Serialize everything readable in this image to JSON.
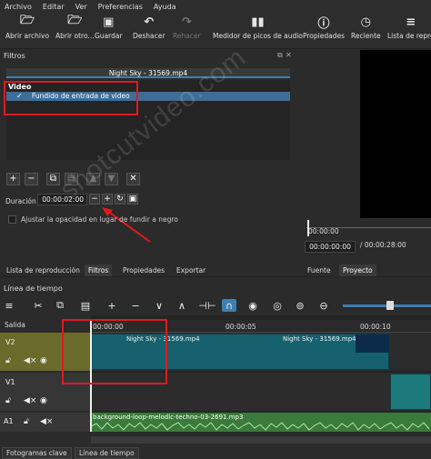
{
  "menu": [
    "Archivo",
    "Editar",
    "Ver",
    "Preferencias",
    "Ayuda"
  ],
  "toolbar": [
    {
      "label": "Abrir archivo",
      "icon": "folder-open-icon",
      "glyph": "▭"
    },
    {
      "label": "Abrir otro...",
      "icon": "folder-open-other-icon",
      "glyph": "▭"
    },
    {
      "label": "Guardar",
      "icon": "save-icon",
      "glyph": "▣"
    },
    {
      "label": "Deshacer",
      "icon": "undo-icon",
      "glyph": "↶"
    },
    {
      "label": "Rehacer",
      "icon": "redo-icon",
      "glyph": "↷"
    },
    {
      "label": "Medidor de picos de audio",
      "icon": "audio-meter-icon",
      "glyph": "▮"
    },
    {
      "label": "Propiedades",
      "icon": "properties-icon",
      "glyph": "ⓘ"
    },
    {
      "label": "Reciente",
      "icon": "recent-icon",
      "glyph": "◷"
    },
    {
      "label": "Lista de repro",
      "icon": "playlist-icon",
      "glyph": "≡"
    }
  ],
  "filters": {
    "title": "Filtros",
    "file": "Night Sky - 31569.mp4",
    "section": "Video",
    "item_check": "✓",
    "item": "Fundido de entrada de video",
    "duration_label": "Duración",
    "duration_value": "00:00:02:00",
    "opacity_label": "Ajustar la opacidad en lugar de fundir a negro"
  },
  "viewer": {
    "ruler_tc": "00:00:00",
    "current_tc": "00:00:00:00",
    "total_tc": "/ 00:00:28:00"
  },
  "tabs": [
    "Lista de reproducción",
    "Filtros",
    "Propiedades",
    "Exportar",
    "Fuente",
    "Proyecto"
  ],
  "timeline": {
    "title": "Línea de tiempo",
    "output_label": "Salida",
    "ruler": [
      "00:00:00",
      "00:00:05",
      "00:00:10"
    ],
    "tracks": [
      "V2",
      "V1",
      "A1"
    ],
    "clips": [
      {
        "label": "Night Sky - 31569.mp4"
      },
      {
        "label": "Night Sky - 31569.mp4"
      }
    ],
    "audio_clip": "background-loop-melodic-techno-03-2691.mp3"
  },
  "bottom_tabs": [
    "Fotogramas clave",
    "Línea de tiempo"
  ],
  "watermark": "shotcutvideo.com",
  "colors": {
    "accent": "#3d7fb0",
    "highlight": "#e0191e",
    "v2_track": "#6a6a2a",
    "clip": "#17606e",
    "audio": "#3a7a3a"
  }
}
